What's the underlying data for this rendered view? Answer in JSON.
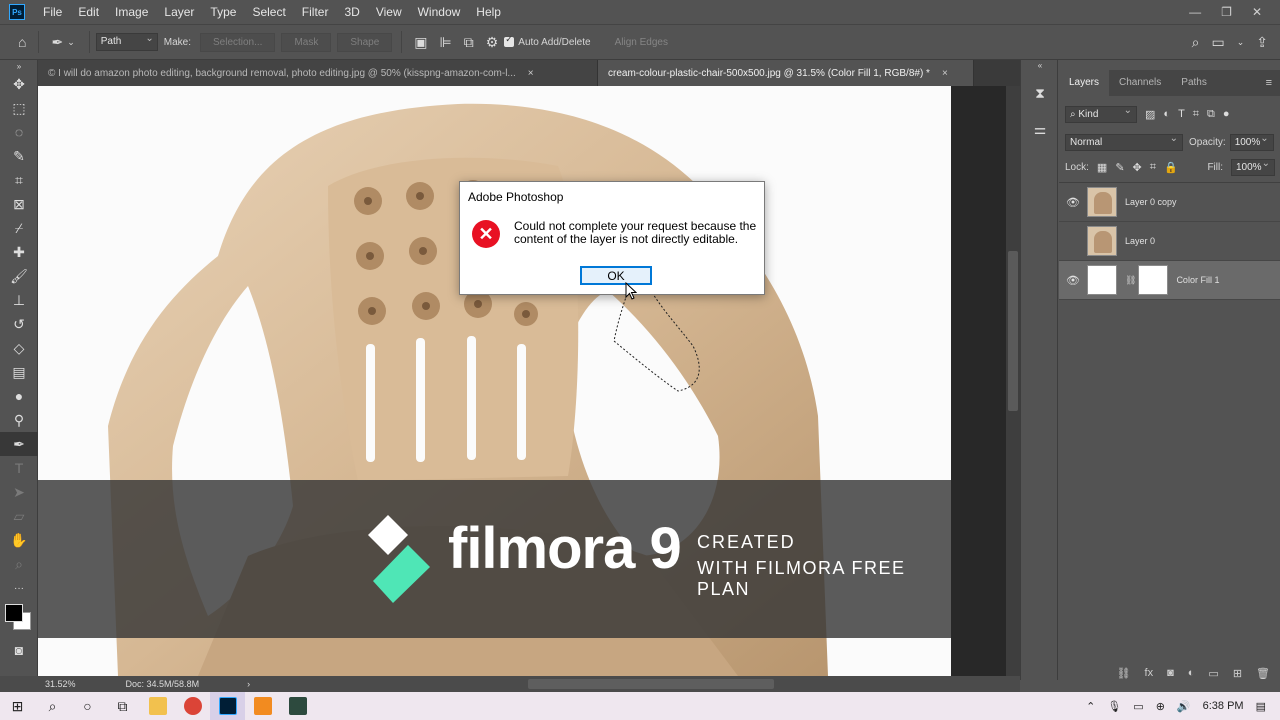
{
  "menubar": {
    "app_icon": "Ps",
    "items": [
      "File",
      "Edit",
      "Image",
      "Layer",
      "Type",
      "Select",
      "Filter",
      "3D",
      "View",
      "Window",
      "Help"
    ],
    "window_controls": [
      "minimize-icon",
      "restore-icon",
      "close-icon"
    ]
  },
  "options": {
    "mode_value": "Path",
    "make_label": "Make:",
    "selection_label": "Selection...",
    "mask_label": "Mask",
    "shape_label": "Shape",
    "auto_add_delete_label": "Auto Add/Delete",
    "align_edges_label": "Align Edges"
  },
  "tabs": [
    {
      "title": "© I will do amazon photo editing, background removal, photo editing.jpg @ 50% (kisspng-amazon-com-l...",
      "close": "×"
    },
    {
      "title": "cream-colour-plastic-chair-500x500.jpg @ 31.5% (Color Fill 1, RGB/8#) *",
      "close": "×"
    }
  ],
  "dialog": {
    "title": "Adobe Photoshop",
    "message": "Could not complete your request because the content of the layer is not directly editable.",
    "ok_label": "OK"
  },
  "watermark": {
    "brand": "filmora 9",
    "line1": "CREATED",
    "line2": "WITH FILMORA FREE PLAN"
  },
  "panel": {
    "tabs": [
      "Layers",
      "Channels",
      "Paths"
    ],
    "filter_kind": "Kind",
    "blend_mode": "Normal",
    "opacity_label": "Opacity:",
    "opacity_value": "100%",
    "lock_label": "Lock:",
    "fill_label": "Fill:",
    "fill_value": "100%",
    "layers": [
      {
        "name": "Layer 0 copy",
        "visible": true,
        "selected": false
      },
      {
        "name": "Layer 0",
        "visible": false,
        "selected": false
      },
      {
        "name": "Color Fill 1",
        "visible": true,
        "selected": true
      }
    ]
  },
  "status": {
    "zoom": "31.52%",
    "doc": "Doc: 34.5M/58.8M",
    "arrow": "›"
  },
  "taskbar": {
    "time": "6:38 PM"
  },
  "colors": {
    "ui_background": "#535353",
    "error_red": "#e81123",
    "ok_border": "#0078d7",
    "filmora_green": "#4fe6b6",
    "chair": "#d9bd9c"
  }
}
